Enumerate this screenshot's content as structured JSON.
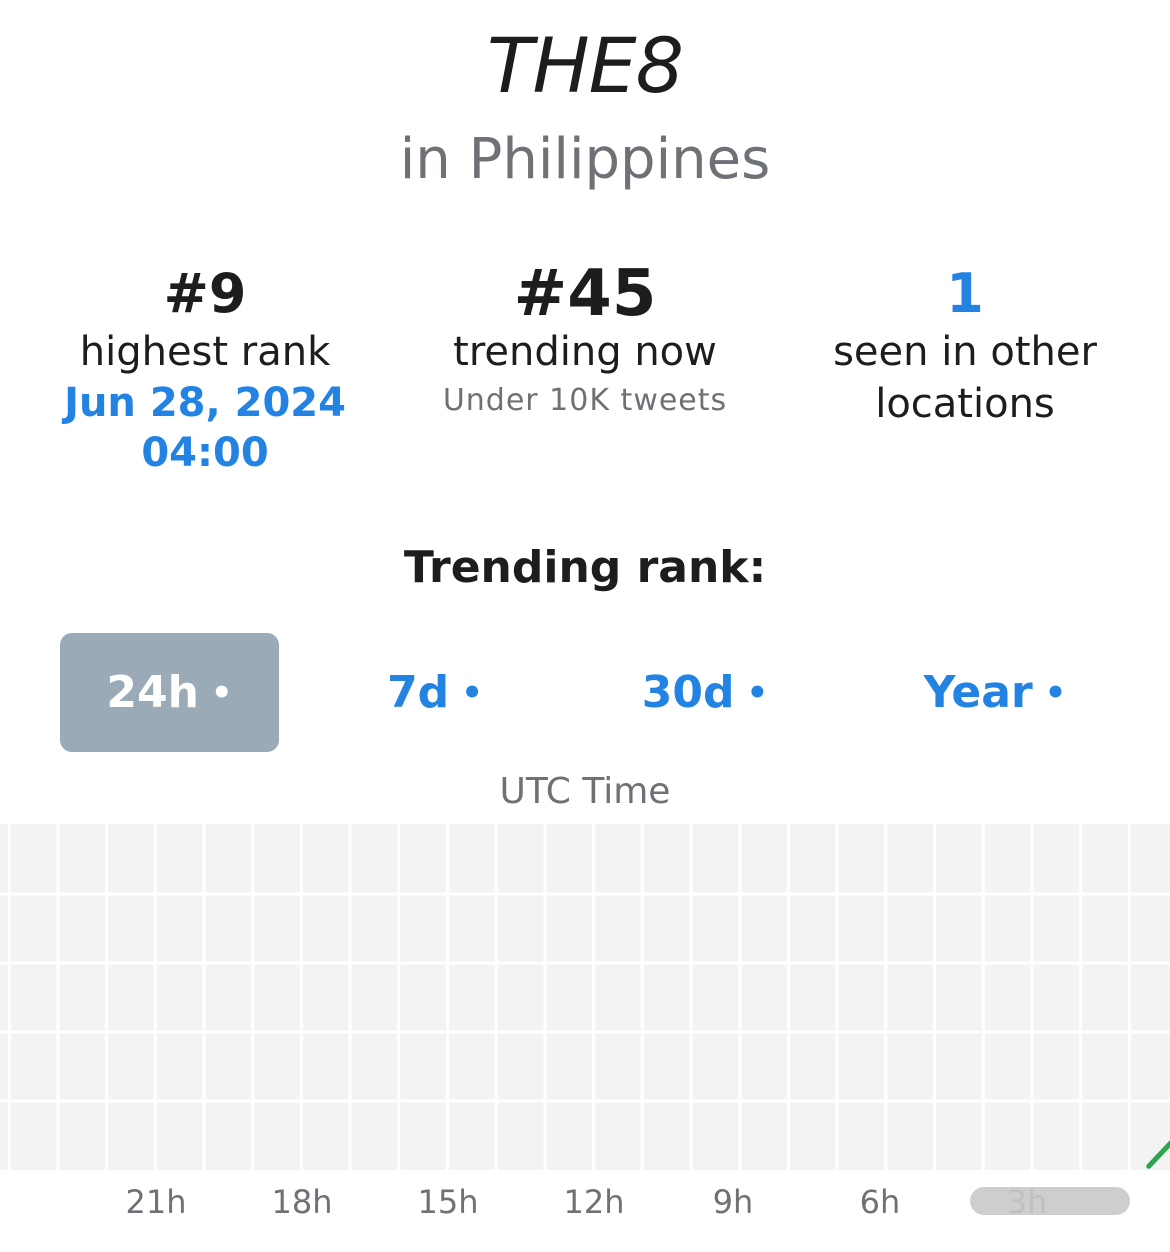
{
  "header": {
    "title": "THE8",
    "subtitle": "in Philippines"
  },
  "stats": {
    "highest": {
      "value": "#9",
      "label": "highest rank",
      "date": "Jun 28, 2024",
      "time": "04:00"
    },
    "current": {
      "value": "#45",
      "label": "trending now",
      "sublabel": "Under 10K tweets"
    },
    "other": {
      "value": "1",
      "label_line1": "seen in other",
      "label_line2": "locations"
    }
  },
  "section_title": "Trending rank:",
  "range_tabs": [
    {
      "label": "24h",
      "dot": "•",
      "active": true
    },
    {
      "label": "7d",
      "dot": "•",
      "active": false
    },
    {
      "label": "30d",
      "dot": "•",
      "active": false
    },
    {
      "label": "Year",
      "dot": "•",
      "active": false
    }
  ],
  "chart_caption": "UTC Time",
  "chart_data": {
    "type": "line",
    "title": "",
    "xlabel": "UTC Time",
    "ylabel": "",
    "x_tick_labels": [
      "21h",
      "18h",
      "15h",
      "12h",
      "9h",
      "6h",
      "3h"
    ],
    "x_hours_ago_range": [
      24,
      0
    ],
    "grid": true,
    "series": [
      {
        "color": "#2ea44f",
        "points": [
          {
            "hours_ago": 0.6,
            "rank": 49
          },
          {
            "hours_ago": 0,
            "rank": 45
          }
        ]
      }
    ],
    "colors": {
      "grid_bg": "#f3f3f3",
      "grid_line": "#ffffff",
      "line": "#2ea44f"
    }
  },
  "colors": {
    "accent": "#2383e2",
    "active_tab_bg": "#9aaab7",
    "text": "#1d1d1f",
    "muted": "#6e7175"
  }
}
